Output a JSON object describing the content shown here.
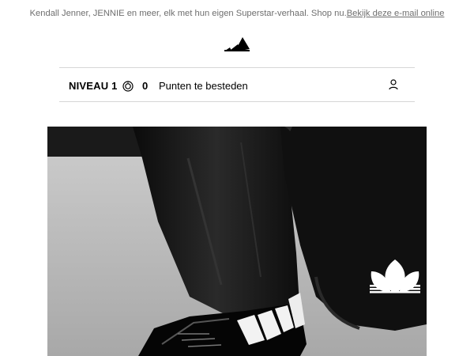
{
  "preheader": {
    "text": "Kendall Jenner, JENNIE en meer, elk met hun eigen Superstar-verhaal. Shop nu.",
    "view_online_link": "Bekijk deze e-mail online"
  },
  "header": {
    "logo_icon": "adidas-performance-logo"
  },
  "member_bar": {
    "level_label": "NIVEAU 1",
    "points_icon": "points-coin-icon",
    "points_value": "0",
    "points_label": "Punten te besteden",
    "account_icon": "user-icon"
  },
  "hero": {
    "logo_icon": "trefoil-logo",
    "colors": {
      "background": "#1a1a1a",
      "floor": "#bdbdbd"
    }
  }
}
